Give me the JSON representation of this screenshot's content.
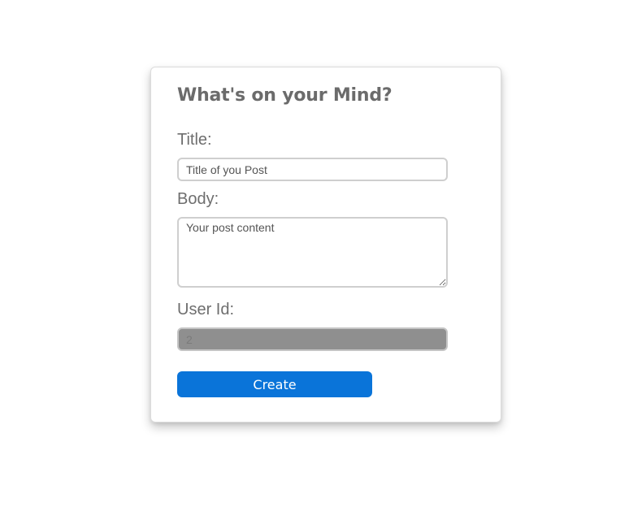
{
  "form": {
    "heading": "What's on your Mind?",
    "title_label": "Title:",
    "title_placeholder": "Title of you Post",
    "title_value": "",
    "body_label": "Body:",
    "body_placeholder": "Your post content",
    "body_value": "",
    "userid_label": "User Id:",
    "userid_value": "2",
    "submit_label": "Create"
  },
  "colors": {
    "heading_text": "#6b6b6b",
    "button_bg": "#0a74d9",
    "disabled_field_bg": "#8f8f8f"
  }
}
